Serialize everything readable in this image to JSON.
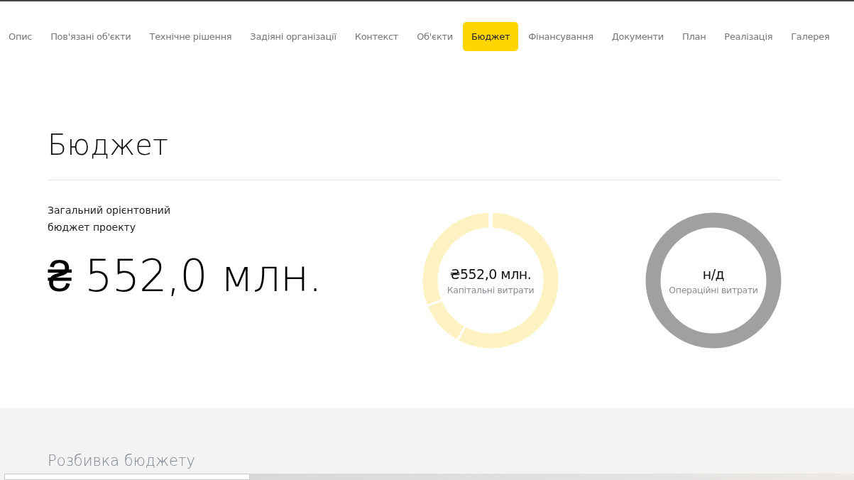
{
  "tabs": [
    {
      "label": "Опис",
      "selected": false
    },
    {
      "label": "Пов'язані об'єкти",
      "selected": false
    },
    {
      "label": "Технічне рішення",
      "selected": false
    },
    {
      "label": "Задіяні організації",
      "selected": false
    },
    {
      "label": "Контекст",
      "selected": false
    },
    {
      "label": "Об'єкти",
      "selected": false
    },
    {
      "label": "Бюджет",
      "selected": true
    },
    {
      "label": "Фінансування",
      "selected": false
    },
    {
      "label": "Документи",
      "selected": false
    },
    {
      "label": "План",
      "selected": false
    },
    {
      "label": "Реалізація",
      "selected": false
    },
    {
      "label": "Галерея",
      "selected": false
    }
  ],
  "section": {
    "title": "Бюджет",
    "total_label": "Загальний орієнтовний бюджет проекту",
    "total_value": "₴ 552,0 млн."
  },
  "donuts": [
    {
      "kind": "segmented",
      "value": "₴552,0 млн.",
      "label": "Капітальні витрати",
      "color": "#fff2c2"
    },
    {
      "kind": "empty",
      "value": "н/д",
      "label": "Операційні витрати",
      "color": "#a0a0a0"
    }
  ],
  "breakdown": {
    "title": "Розбивка бюджету"
  }
}
